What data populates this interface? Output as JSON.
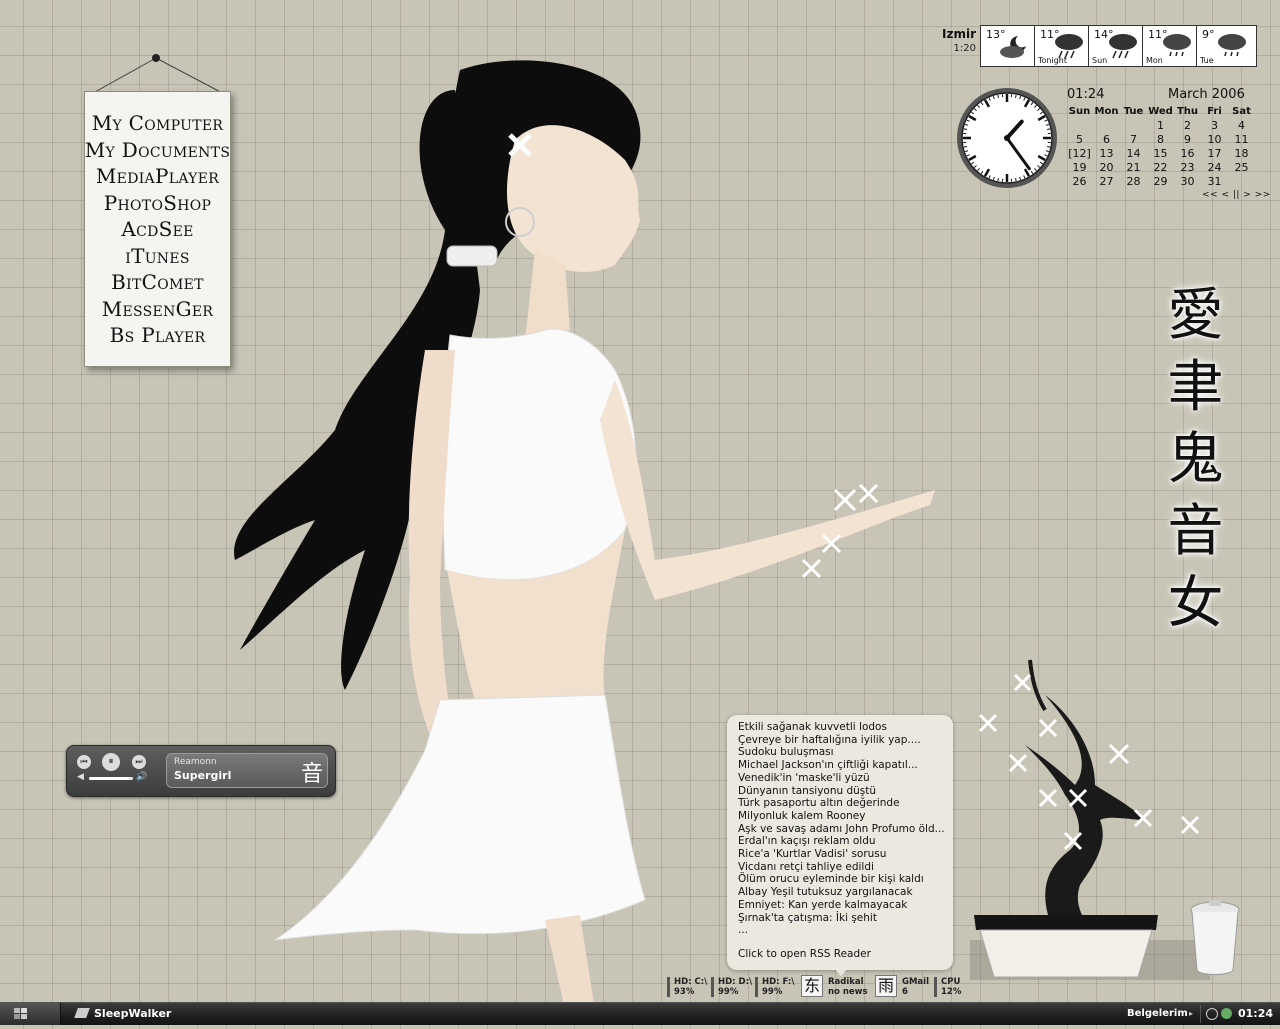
{
  "menu": {
    "items": [
      "My Computer",
      "My Documents",
      "MediaPlayer",
      "PhotoShop",
      "AcdSee",
      "iTunes",
      "BitComet",
      "MessenGer",
      "Bs Player"
    ]
  },
  "weather": {
    "city": "Izmir",
    "time": "1:20",
    "forecast": [
      {
        "temp": "13°",
        "day": "",
        "icon": "moon-cloud-icon"
      },
      {
        "temp": "11°",
        "day": "Tonight",
        "icon": "storm-cloud-icon"
      },
      {
        "temp": "14°",
        "day": "Sun",
        "icon": "storm-cloud-icon"
      },
      {
        "temp": "11°",
        "day": "Mon",
        "icon": "rain-cloud-icon"
      },
      {
        "temp": "9°",
        "day": "Tue",
        "icon": "rain-cloud-icon"
      }
    ]
  },
  "clock": {
    "hour": 1,
    "minute": 24
  },
  "calendar": {
    "time": "01:24",
    "month": "March 2006",
    "weekdays": [
      "Sun",
      "Mon",
      "Tue",
      "Wed",
      "Thu",
      "Fri",
      "Sat"
    ],
    "weeks": [
      [
        "",
        "",
        "",
        "1",
        "2",
        "3",
        "4"
      ],
      [
        "5",
        "6",
        "7",
        "8",
        "9",
        "10",
        "11"
      ],
      [
        "[12]",
        "13",
        "14",
        "15",
        "16",
        "17",
        "18"
      ],
      [
        "19",
        "20",
        "21",
        "22",
        "23",
        "24",
        "25"
      ],
      [
        "26",
        "27",
        "28",
        "29",
        "30",
        "31",
        ""
      ]
    ],
    "nav": "<< < || > >>"
  },
  "kanji": [
    "愛",
    "聿",
    "鬼",
    "音",
    "女"
  ],
  "player": {
    "artist": "Reamonn",
    "title": "Supergirl",
    "glyph": "音",
    "progress": 0.9
  },
  "rss": {
    "items": [
      "Etkili sağanak kuvvetli lodos",
      "Çevreye bir haftalığına iyilik yap....",
      "Sudoku buluşması",
      "Michael Jackson'ın çiftliği kapatıl...",
      "Venedik'in 'maske'li yüzü",
      "Dünyanın tansiyonu düştü",
      "Türk pasaportu altın değerinde",
      "Milyonluk kalem Rooney",
      "Aşk ve savaş adamı John Profumo öld...",
      "Erdal'ın kaçışı reklam oldu",
      "Rice'a 'Kurtlar Vadisi' sorusu",
      "Vicdanı retçi tahliye edildi",
      "Ölüm orucu eyleminde bir kişi kaldı",
      "Albay Yeşil tutuksuz yargılanacak",
      "Emniyet: Kan yerde kalmayacak",
      "Şırnak'ta çatışma: İki şehit",
      "..."
    ],
    "open_label": "Click to open RSS Reader"
  },
  "sysinfo": {
    "hd_c": {
      "label": "HD: C:\\",
      "value": "93%"
    },
    "hd_d": {
      "label": "HD: D:\\",
      "value": "99%"
    },
    "hd_f": {
      "label": "HD: F:\\",
      "value": "99%"
    },
    "glyph1": "东",
    "radikal": {
      "label": "Radikal",
      "value": "no news"
    },
    "glyph2": "雨",
    "gmail": {
      "label": "GMail",
      "value": "6"
    },
    "cpu": {
      "label": "CPU",
      "value": "12%"
    }
  },
  "taskbar": {
    "task": "SleepWalker",
    "belgelerim": "Belgelerim",
    "clock": "01:24"
  }
}
